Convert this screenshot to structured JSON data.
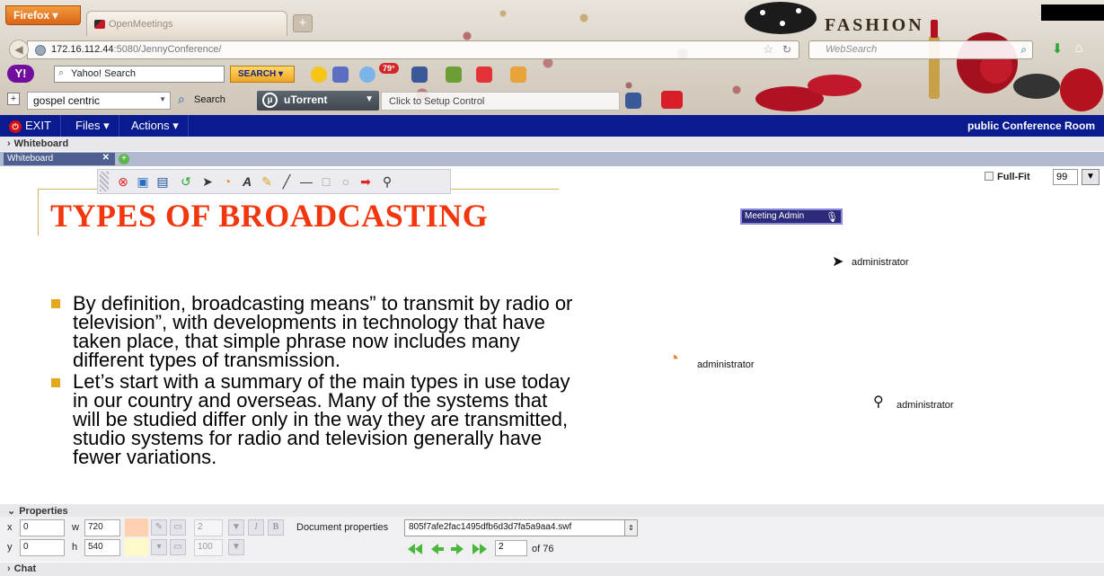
{
  "browser": {
    "firefox_label": "Firefox ▾",
    "tab_title": "OpenMeetings",
    "url_host": "172.16.112.44",
    "url_rest": ":5080/JennyConference/",
    "websearch_placeholder": "WebSearch",
    "theme_word": "FASHION"
  },
  "yahoo_toolbar": {
    "search_placeholder": "Yahoo! Search",
    "search_button": "SEARCH",
    "temp": "79°"
  },
  "custom_toolbar": {
    "query": "gospel centric",
    "search_label": "Search",
    "utorrent_label": "uTorrent",
    "setup_text": "Click to Setup Control"
  },
  "appbar": {
    "exit": "EXIT",
    "files": "Files",
    "actions": "Actions",
    "room_title": "public Conference Room"
  },
  "whiteboard": {
    "section_label": "Whiteboard",
    "tab_label": "Whiteboard",
    "fullfit_label": "Full-Fit",
    "zoom": "99",
    "meeting_label": "Meeting Admin",
    "cursors": [
      {
        "label": "administrator"
      },
      {
        "label": "administrator"
      },
      {
        "label": "administrator"
      }
    ]
  },
  "slide": {
    "title": "TYPES OF BROADCASTING",
    "bullets": [
      "By definition, broadcasting means” to transmit by radio or television”, with developments in technology that have taken place, that simple phrase now includes many different types of transmission.",
      " Let’s start with a summary of the main types in use today in our country and overseas. Many of the systems that will be studied differ only in the way they are transmitted, studio systems for radio and television generally have fewer variations."
    ]
  },
  "properties": {
    "section_label": "Properties",
    "x_label": "x",
    "x": "0",
    "y_label": "y",
    "y": "0",
    "w_label": "w",
    "w": "720",
    "h_label": "h",
    "h": "540",
    "line_width": "2",
    "opacity": "100",
    "italic": "I",
    "bold": "B",
    "doc_label": "Document properties",
    "doc_file": "805f7afe2fac1495dfb6d3d7fa5a9aa4.swf",
    "page": "2",
    "of_pages": "of 76"
  },
  "chat": {
    "section_label": "Chat"
  },
  "colors": {
    "appbar": "#0a1a8f",
    "slide_title": "#f2370f",
    "bullet": "#e3a81b",
    "fill_swatch": "#ffd1b0",
    "line_swatch": "#fff8c8"
  }
}
